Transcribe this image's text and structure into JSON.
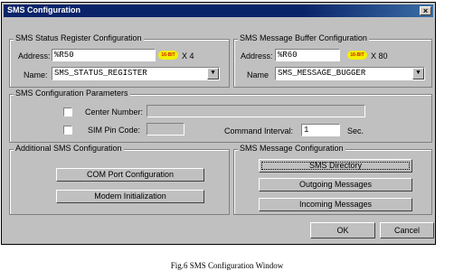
{
  "window": {
    "title": "SMS Configuration",
    "close_glyph": "×"
  },
  "status_register": {
    "legend": "SMS Status Register Configuration",
    "address_label": "Address:",
    "address_value": "%R50",
    "badge": "16-BIT",
    "multiplier": "X 4",
    "name_label": "Name:",
    "name_value": "SMS_STATUS_REGISTER"
  },
  "message_buffer": {
    "legend": "SMS Message Buffer Configuration",
    "address_label": "Address:",
    "address_value": "%R60",
    "badge": "16-BIT",
    "multiplier": "X 80",
    "name_label": "Name",
    "name_value": "SMS_MESSAGE_BUGGER"
  },
  "parameters": {
    "legend": "SMS Configuration Parameters",
    "center_number_label": "Center Number:",
    "center_number_value": "",
    "sim_pin_label": "SIM Pin Code:",
    "sim_pin_value": "",
    "command_interval_label": "Command Interval:",
    "command_interval_value": "1",
    "unit": "Sec."
  },
  "additional": {
    "legend": "Additional SMS Configuration",
    "com_port_button": "COM Port Configuration",
    "modem_init_button": "Modem Initialization"
  },
  "message_config": {
    "legend": "SMS Message Configuration",
    "directory_button": "SMS Directory",
    "outgoing_button": "Outgoing Messages",
    "incoming_button": "Incoming Messages"
  },
  "footer": {
    "ok": "OK",
    "cancel": "Cancel"
  },
  "caption": "Fig.6 SMS Configuration Window",
  "colors": {
    "titlebar": "#0a246a",
    "dialog_face": "#c0c0c0",
    "badge": "#f3f000"
  },
  "icons": [
    "close-icon",
    "dropdown-arrow-icon"
  ]
}
